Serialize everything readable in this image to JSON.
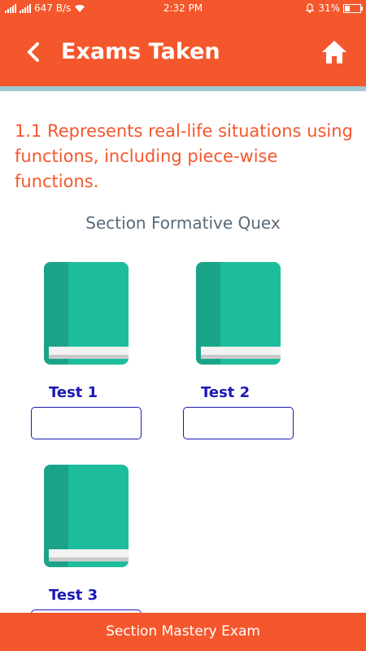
{
  "status_bar": {
    "net_speed": "647 B/s",
    "time": "2:32 PM",
    "battery": "31%"
  },
  "app_bar": {
    "title": "Exams Taken",
    "back_icon": "back-chevron-icon",
    "home_icon": "home-icon"
  },
  "topic": "1.1 Represents real-life situations using functions, including piece-wise functions.",
  "section_label": "Section Formative Quex",
  "tests": [
    {
      "label": "Test 1",
      "score": ""
    },
    {
      "label": "Test 2",
      "score": ""
    },
    {
      "label": "Test 3",
      "score": ""
    }
  ],
  "bottom_button": "Section Mastery Exam",
  "colors": {
    "primary": "#f4572c",
    "accent_strip": "#9fc9d3",
    "book": "#1dbd9c",
    "book_spine": "#1ba388",
    "label_blue": "#1b18b8"
  }
}
